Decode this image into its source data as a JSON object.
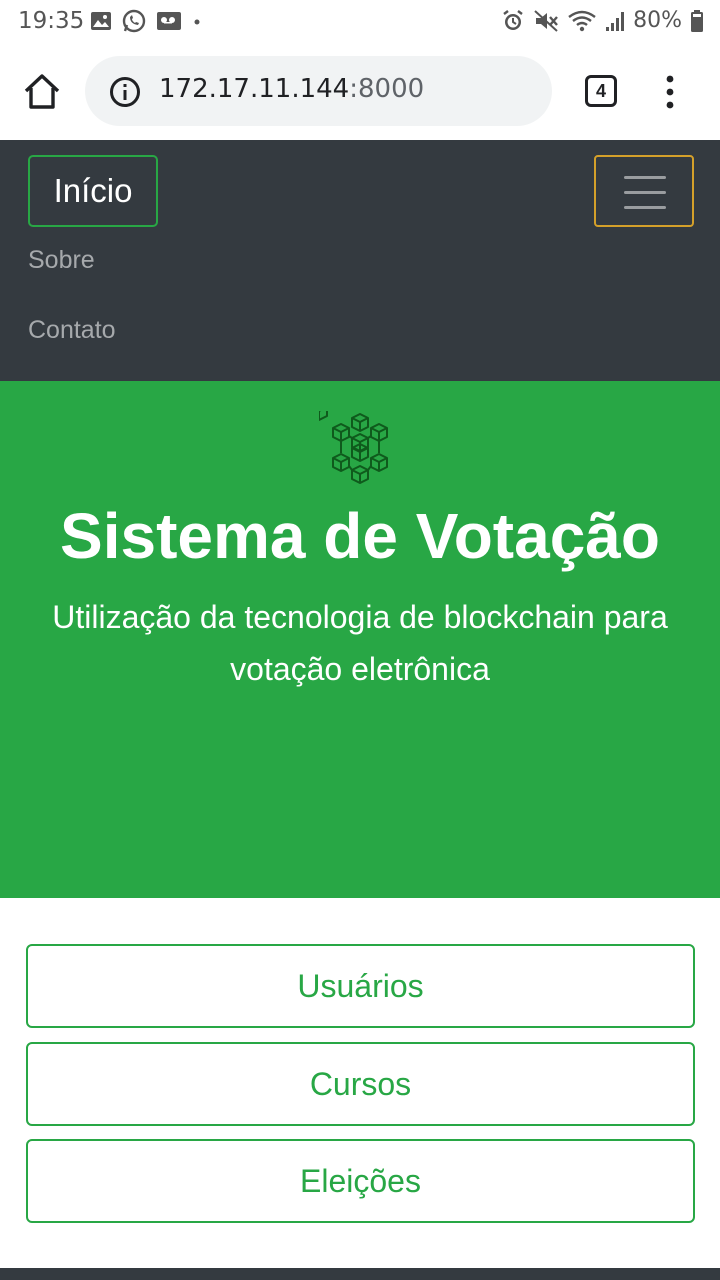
{
  "status_bar": {
    "time": "19:35",
    "battery": "80%",
    "icons": [
      "image-icon",
      "whatsapp-icon",
      "voicemail-icon",
      "dot-icon",
      "alarm-icon",
      "mute-icon",
      "wifi-icon",
      "signal-icon",
      "battery-icon"
    ]
  },
  "browser": {
    "url_host": "172.17.11.144",
    "url_port": ":8000",
    "tab_count": "4"
  },
  "navbar": {
    "brand": "Início",
    "links": [
      "Sobre",
      "Contato"
    ],
    "toggler_border_color": "#d4a02a"
  },
  "hero": {
    "title": "Sistema de Votação",
    "subtitle": "Utilização da tecnologia de blockchain para votação eletrônica",
    "background_color": "#28a745",
    "icon": "blockchain-icon"
  },
  "actions": [
    "Usuários",
    "Cursos",
    "Eleições"
  ],
  "colors": {
    "accent": "#28a745",
    "navbar": "#343a40"
  }
}
